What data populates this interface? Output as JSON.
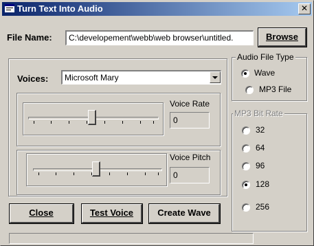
{
  "window": {
    "title": "Turn Text Into Audio",
    "close_glyph": "✕"
  },
  "file": {
    "label": "File Name:",
    "value": "C:\\developement\\webb\\web browser\\untitled.",
    "browse_label": "Browse"
  },
  "voices": {
    "label": "Voices:",
    "selected": "Microsoft Mary"
  },
  "voice_rate": {
    "label": "Voice Rate",
    "value": "0",
    "slider_position": 0.5
  },
  "voice_pitch": {
    "label": "Voice Pitch",
    "value": "0",
    "slider_position": 0.5
  },
  "audio_file_type": {
    "title": "Audio File Type",
    "options": [
      "Wave",
      "MP3 File"
    ],
    "selected": "Wave"
  },
  "mp3_bit_rate": {
    "title": "MP3 Bit Rate",
    "options": [
      "32",
      "64",
      "96",
      "128",
      "256"
    ],
    "selected": "128",
    "enabled": false
  },
  "buttons": {
    "close": "Close",
    "test_voice": "Test Voice",
    "create_wave": "Create Wave"
  },
  "icons": {
    "app": "app-window-icon",
    "dropdown": "chevron-down-icon"
  }
}
